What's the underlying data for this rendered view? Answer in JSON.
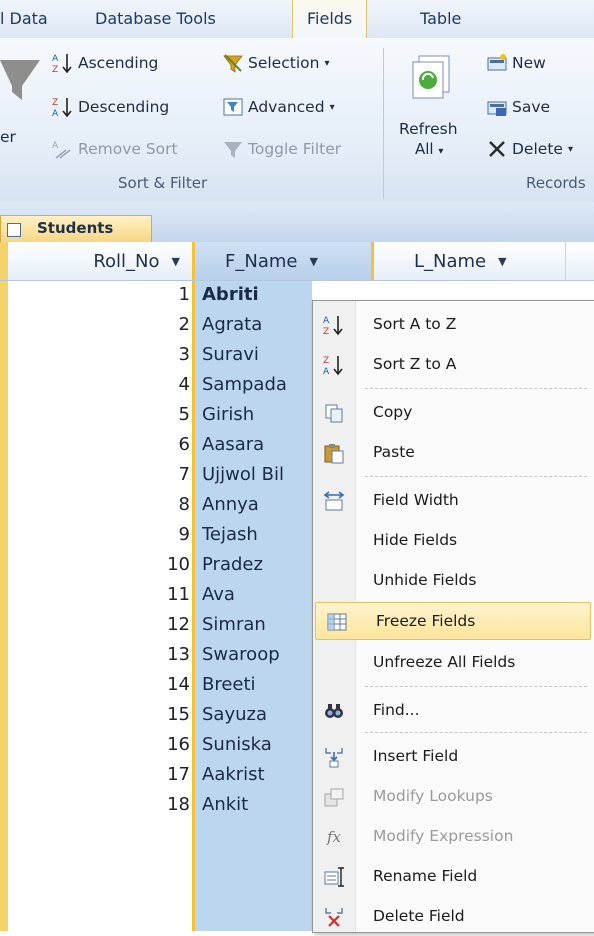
{
  "tabs": [
    "l Data",
    "Database Tools",
    "Fields",
    "Table"
  ],
  "ribbon": {
    "partial_left": "er",
    "sort_filter": {
      "ascending": "Ascending",
      "descending": "Descending",
      "remove_sort": "Remove Sort",
      "selection": "Selection",
      "advanced": "Advanced",
      "toggle_filter": "Toggle Filter",
      "group_label": "Sort & Filter"
    },
    "records": {
      "refresh": "Refresh",
      "refresh_all": "All",
      "new": "New",
      "save": "Save",
      "delete": "Delete",
      "group_label": "Records"
    }
  },
  "object_tab": "Students",
  "columns": [
    "Roll_No",
    "F_Name",
    "L_Name"
  ],
  "rows": [
    {
      "roll": "1",
      "name": "Abriti"
    },
    {
      "roll": "2",
      "name": "Agrata"
    },
    {
      "roll": "3",
      "name": "Suravi"
    },
    {
      "roll": "4",
      "name": "Sampada"
    },
    {
      "roll": "5",
      "name": "Girish"
    },
    {
      "roll": "6",
      "name": "Aasara"
    },
    {
      "roll": "7",
      "name": "Ujjwol Bil"
    },
    {
      "roll": "8",
      "name": "Annya"
    },
    {
      "roll": "9",
      "name": "Tejash"
    },
    {
      "roll": "10",
      "name": "Pradez"
    },
    {
      "roll": "11",
      "name": "Ava"
    },
    {
      "roll": "12",
      "name": "Simran"
    },
    {
      "roll": "13",
      "name": "Swaroop"
    },
    {
      "roll": "14",
      "name": "Breeti"
    },
    {
      "roll": "15",
      "name": "Sayuza"
    },
    {
      "roll": "16",
      "name": "Suniska"
    },
    {
      "roll": "17",
      "name": "Aakrist"
    },
    {
      "roll": "18",
      "name": "Ankit"
    }
  ],
  "menu": [
    {
      "label": "Sort A to Z",
      "icon": "sort-az-icon"
    },
    {
      "label": "Sort Z to A",
      "icon": "sort-za-icon"
    },
    {
      "label": "Copy",
      "icon": "copy-icon"
    },
    {
      "label": "Paste",
      "icon": "paste-icon"
    },
    {
      "label": "Field Width",
      "icon": "field-width-icon"
    },
    {
      "label": "Hide Fields"
    },
    {
      "label": "Unhide Fields"
    },
    {
      "label": "Freeze Fields",
      "icon": "freeze-fields-icon",
      "highlighted": true
    },
    {
      "label": "Unfreeze All Fields"
    },
    {
      "label": "Find...",
      "icon": "find-icon"
    },
    {
      "label": "Insert Field",
      "icon": "insert-field-icon"
    },
    {
      "label": "Modify Lookups",
      "icon": "modify-lookups-icon",
      "disabled": true
    },
    {
      "label": "Modify Expression",
      "icon": "modify-expression-icon",
      "disabled": true
    },
    {
      "label": "Rename Field",
      "icon": "rename-field-icon"
    },
    {
      "label": "Delete Field",
      "icon": "delete-field-icon"
    }
  ]
}
